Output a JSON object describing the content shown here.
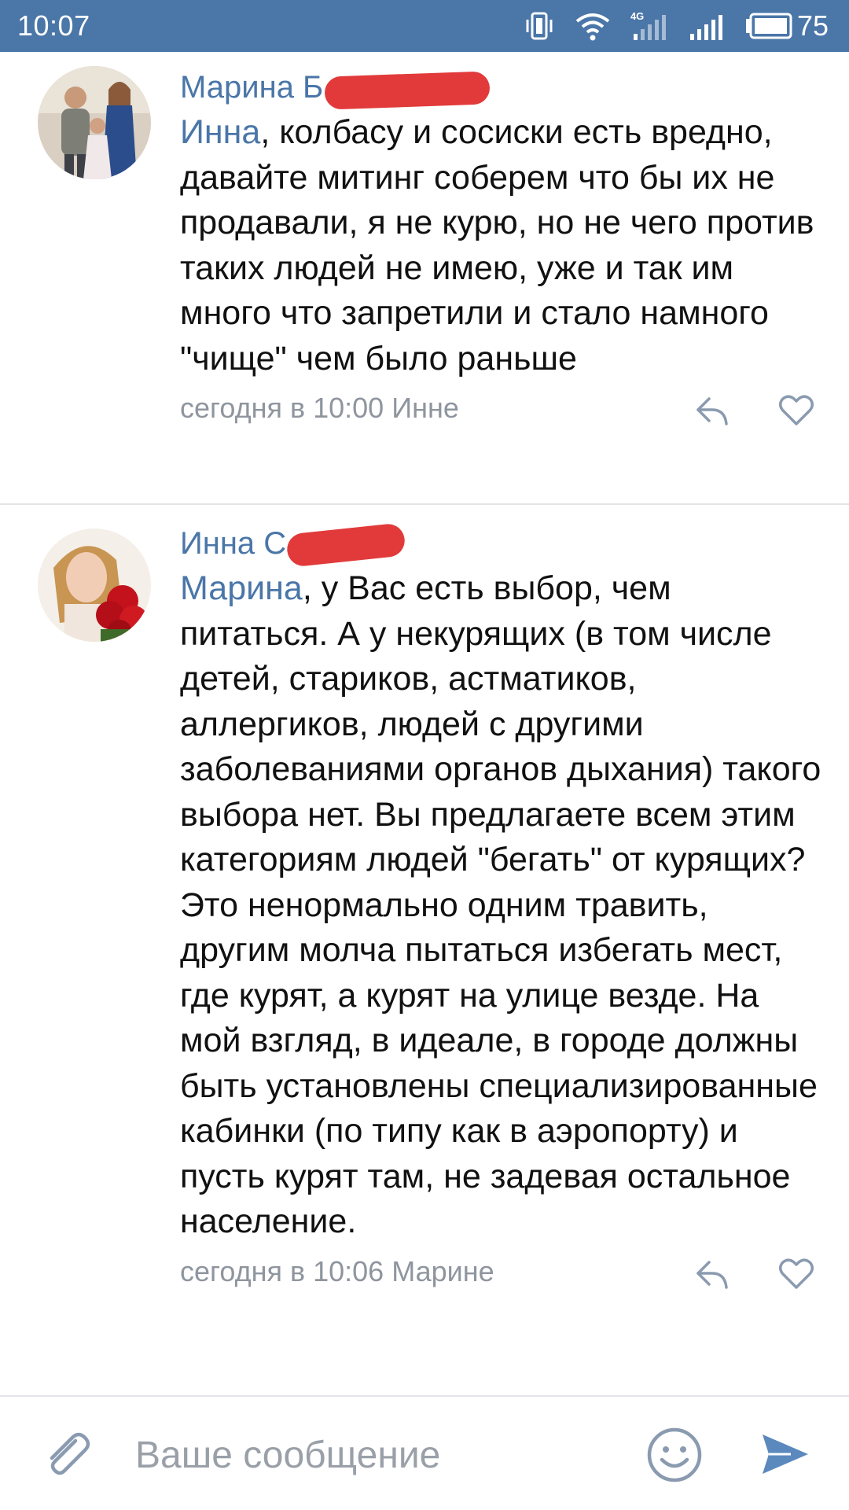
{
  "status_bar": {
    "time": "10:07",
    "network_label": "4G",
    "battery_level": "75",
    "icons": [
      "vibrate-icon",
      "wifi-icon",
      "signal-4g-icon",
      "signal-icon",
      "battery-icon"
    ]
  },
  "comments": [
    {
      "author": "Марина Б",
      "reply_to": "Инна",
      "text": ", колбасу и сосиски есть вредно, давайте митинг соберем что бы их не продавали, я не курю, но не чего против таких людей не имею, уже и так им много что запретили и стало намного \"чище\" чем было раньше",
      "meta": "сегодня в 10:00 Инне"
    },
    {
      "author": "Инна С",
      "reply_to": "Марина",
      "text": ", у Вас есть выбор, чем питаться. А у некурящих (в том числе детей, стариков, астматиков, аллергиков, людей с другими заболеваниями органов дыхания) такого выбора нет. Вы предлагаете всем этим категориям людей \"бегать\" от курящих? Это ненормально одним травить, другим молча пытаться избегать мест, где курят, а курят на улице везде. На мой взгляд, в идеале, в городе должны быть установлены специализированные кабинки (по типу как в аэропорту) и пусть курят там, не задевая остальное население.",
      "meta": "сегодня в 10:06 Марине"
    }
  ],
  "input_bar": {
    "placeholder": "Ваше сообщение",
    "value": "",
    "icons": [
      "attach-icon",
      "emoji-icon",
      "send-icon"
    ]
  },
  "colors": {
    "status_bar": "#4a76a8",
    "link": "#4a76a8",
    "meta_text": "#8f959e",
    "icon": "#8a9bb0",
    "redaction": "#e23a3a",
    "send": "#5b88bd"
  }
}
